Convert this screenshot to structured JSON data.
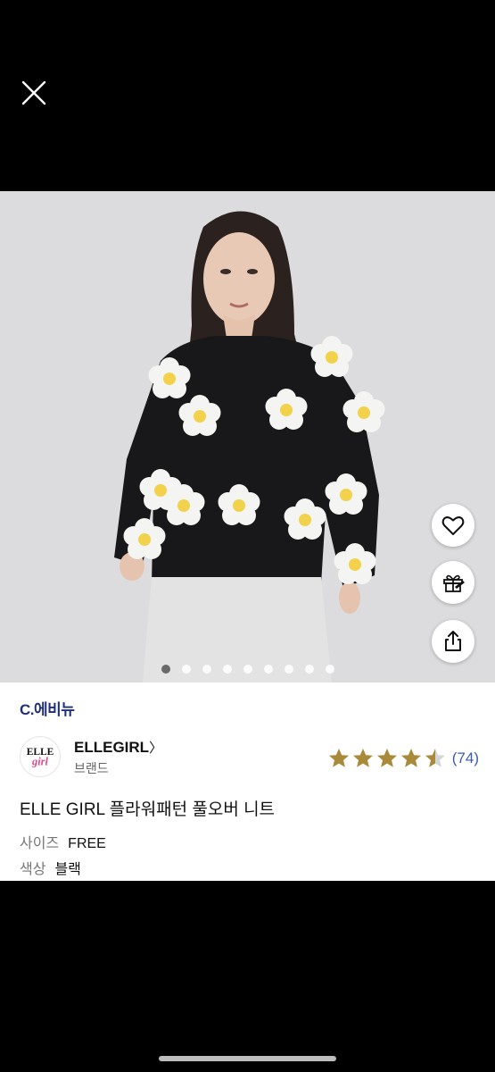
{
  "shop": {
    "name": "C.에비뉴"
  },
  "brand": {
    "logo_top": "ELLE",
    "logo_bottom": "girl",
    "name": "ELLEGIRL",
    "chevron": "〉",
    "subtitle": "브랜드"
  },
  "rating": {
    "stars_value": 4.5,
    "stars_max": 5,
    "review_count": "(74)",
    "star_color": "#a98a3a"
  },
  "product": {
    "title": "ELLE GIRL 플라워패턴 풀오버 니트",
    "size_label": "사이즈",
    "size_value": "FREE",
    "color_label": "색상",
    "color_value": "블랙"
  },
  "gallery": {
    "total_images": 9,
    "active_index": 0
  },
  "icons": {
    "close": "close-icon",
    "favorite": "heart-icon",
    "gift": "gift-icon",
    "share": "share-icon"
  },
  "colors": {
    "brand_navy": "#1f2f7a",
    "link_blue": "#3a5bb0"
  }
}
